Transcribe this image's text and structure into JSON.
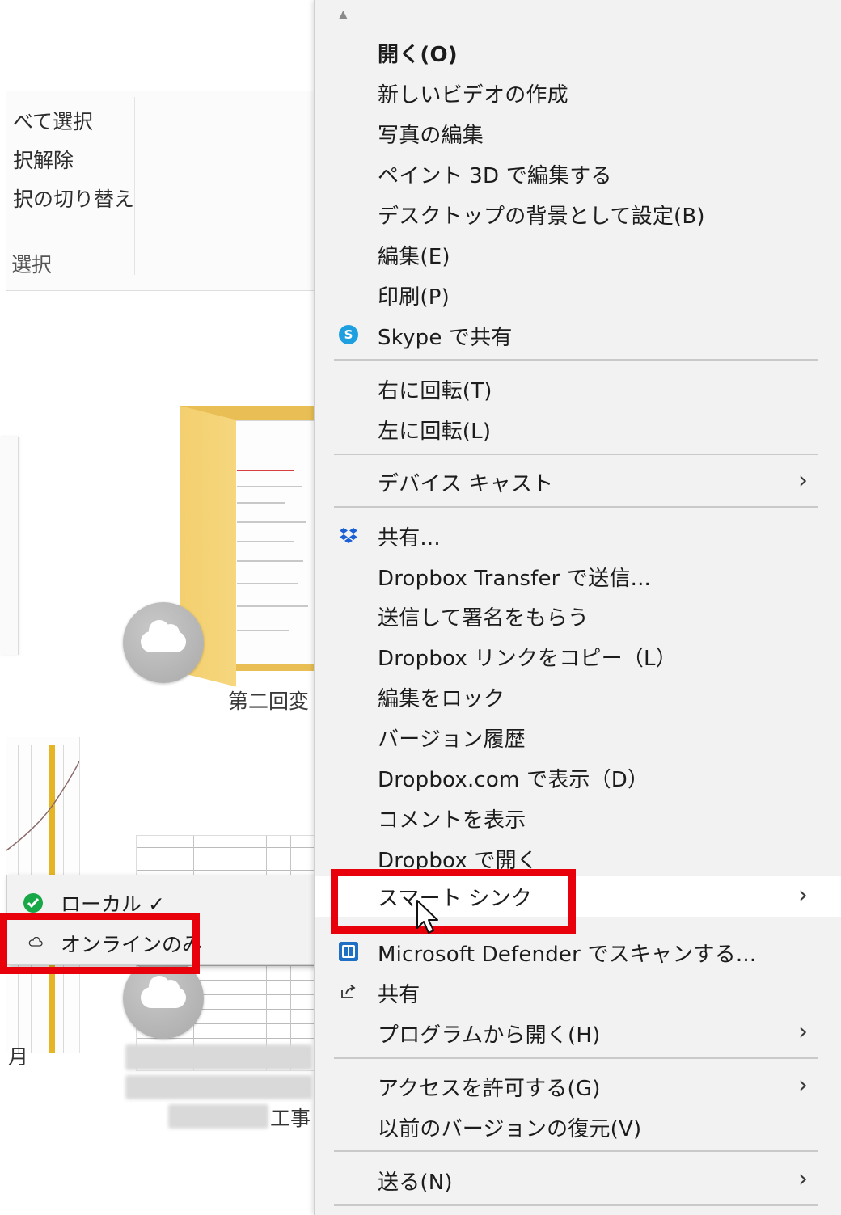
{
  "ribbon": {
    "items": [
      "べて選択",
      "択解除",
      "択の切り替え"
    ],
    "group_label": "選択"
  },
  "files": {
    "folder_caption": "第二回変",
    "month_caption": "月",
    "koji_caption": "工事"
  },
  "smart_sync_submenu": {
    "items": [
      {
        "label": "ローカル ✓",
        "icon": "green-check-icon"
      },
      {
        "label": "オンラインのみ",
        "icon": "cloud-outline-icon"
      }
    ]
  },
  "context_menu": {
    "scroll_up": "▲",
    "items": [
      {
        "label": "開く(O)",
        "bold": true
      },
      {
        "label": "新しいビデオの作成"
      },
      {
        "label": "写真の編集"
      },
      {
        "label": "ペイント 3D で編集する"
      },
      {
        "label": "デスクトップの背景として設定(B)"
      },
      {
        "label": "編集(E)"
      },
      {
        "label": "印刷(P)"
      },
      {
        "label": "Skype で共有",
        "icon": "skype-icon"
      },
      {
        "label": "右に回転(T)"
      },
      {
        "label": "左に回転(L)"
      },
      {
        "label": "デバイス キャスト",
        "submenu": true
      },
      {
        "label": "共有...",
        "icon": "dropbox-icon"
      },
      {
        "label": "Dropbox Transfer で送信..."
      },
      {
        "label": "送信して署名をもらう"
      },
      {
        "label": "Dropbox リンクをコピー（L）"
      },
      {
        "label": "編集をロック"
      },
      {
        "label": "バージョン履歴"
      },
      {
        "label": "Dropbox.com で表示（D）"
      },
      {
        "label": "コメントを表示"
      },
      {
        "label": "Dropbox で開く"
      },
      {
        "label": "スマート シンク",
        "submenu": true,
        "highlighted": true
      },
      {
        "label": "Microsoft Defender でスキャンする...",
        "icon": "defender-icon"
      },
      {
        "label": "共有",
        "icon": "share-icon"
      },
      {
        "label": "プログラムから開く(H)",
        "submenu": true
      },
      {
        "label": "アクセスを許可する(G)",
        "submenu": true
      },
      {
        "label": "以前のバージョンの復元(V)"
      },
      {
        "label": "送る(N)",
        "submenu": true
      }
    ]
  },
  "colors": {
    "menu_bg": "#f2f2f2",
    "highlight_box": "#e8000b",
    "folder": "#e9bf55",
    "green_check": "#18a848"
  }
}
